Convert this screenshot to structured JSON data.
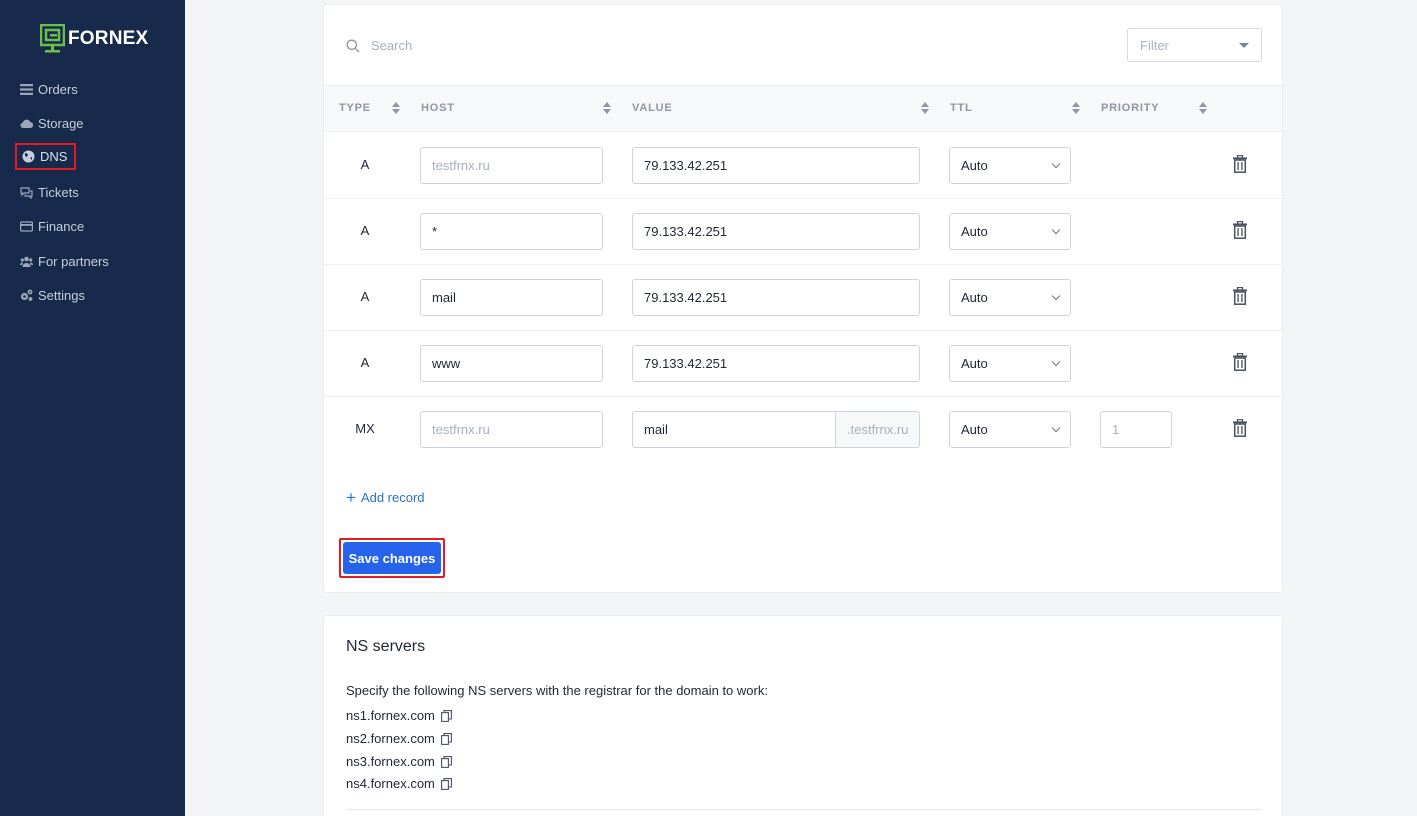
{
  "brand": {
    "name": "FORNEX",
    "logo_color": "#6cc04a"
  },
  "sidebar": {
    "items": [
      {
        "label": "Orders",
        "icon": "list-icon"
      },
      {
        "label": "Storage",
        "icon": "cloud-icon"
      },
      {
        "label": "DNS",
        "icon": "globe-icon",
        "active": true
      },
      {
        "label": "Tickets",
        "icon": "chat-icon"
      },
      {
        "label": "Finance",
        "icon": "card-icon"
      },
      {
        "label": "For partners",
        "icon": "users-icon"
      },
      {
        "label": "Settings",
        "icon": "gear-icon"
      }
    ]
  },
  "records": {
    "search_placeholder": "Search",
    "filter_placeholder": "Filter",
    "columns": [
      "TYPE",
      "HOST",
      "VALUE",
      "TTL",
      "PRIORITY"
    ],
    "rows": [
      {
        "type": "A",
        "host": "",
        "host_placeholder": "testfrnx.ru",
        "value": "79.133.42.251",
        "ttl": "Auto"
      },
      {
        "type": "A",
        "host": "*",
        "host_placeholder": "testfrnx.ru",
        "value": "79.133.42.251",
        "ttl": "Auto"
      },
      {
        "type": "A",
        "host": "mail",
        "host_placeholder": "testfrnx.ru",
        "value": "79.133.42.251",
        "ttl": "Auto"
      },
      {
        "type": "A",
        "host": "www",
        "host_placeholder": "testfrnx.ru",
        "value": "79.133.42.251",
        "ttl": "Auto"
      },
      {
        "type": "MX",
        "host": "",
        "host_placeholder": "testfrnx.ru",
        "value": "mail",
        "value_suffix": ".testfrnx.ru",
        "ttl": "Auto",
        "priority": "",
        "priority_placeholder": "1"
      }
    ],
    "add_record_label": "Add record",
    "save_label": "Save changes",
    "accent": "#2563eb",
    "highlight": "#e31b23"
  },
  "ns": {
    "title": "NS servers",
    "description": "Specify the following NS servers with the registrar for the domain to work:",
    "servers": [
      "ns1.fornex.com",
      "ns2.fornex.com",
      "ns3.fornex.com",
      "ns4.fornex.com"
    ]
  }
}
